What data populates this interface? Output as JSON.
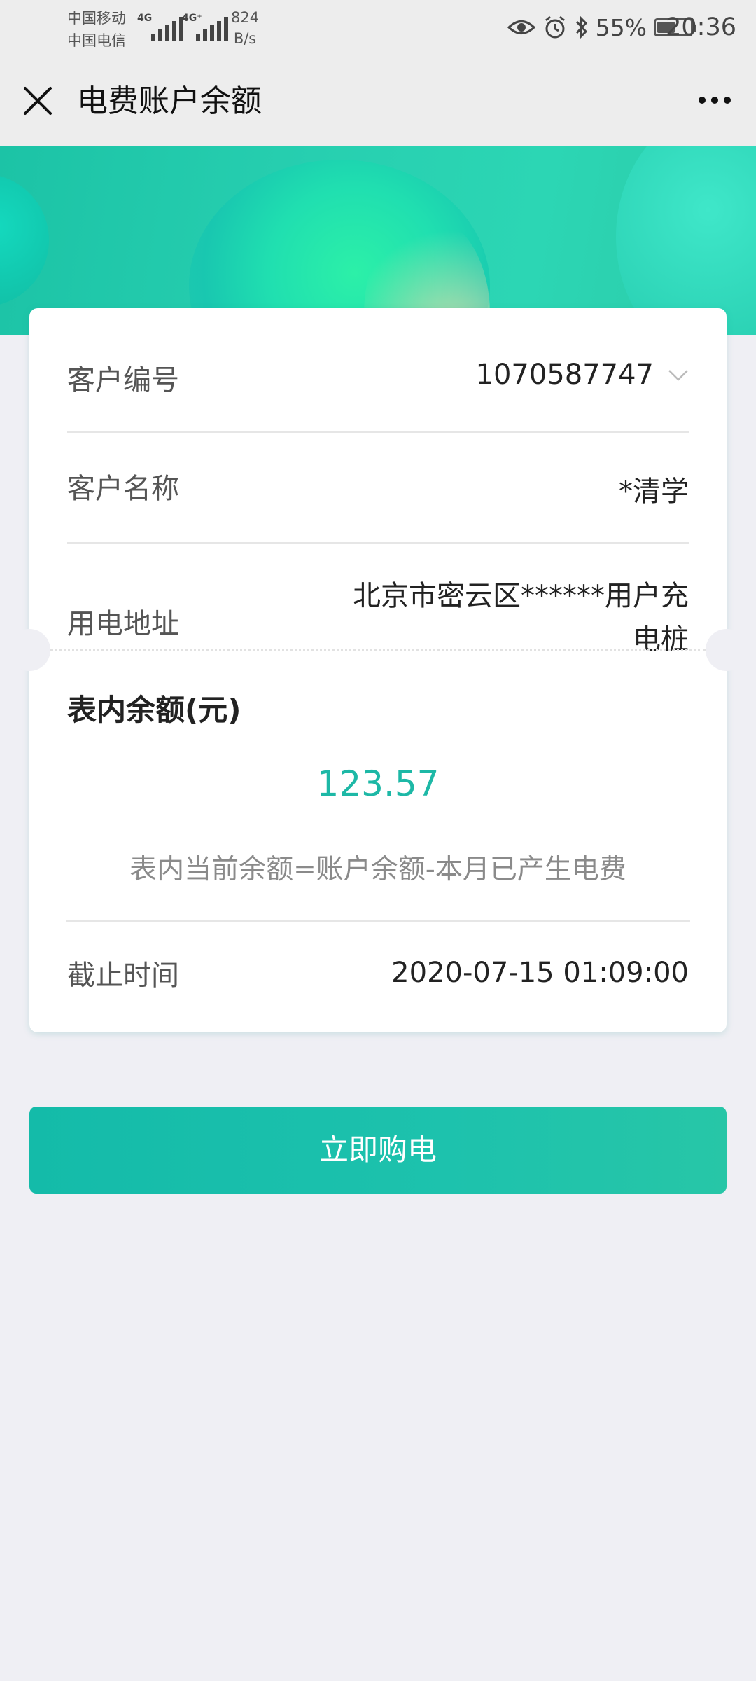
{
  "status_bar": {
    "carrier_1": "中国移动",
    "carrier_2": "中国电信",
    "net_1": "4G",
    "net_2": "4G⁺",
    "speed_value": "824",
    "speed_unit": "B/s",
    "battery_percent": "55%",
    "battery_level": 0.55,
    "time": "20:36"
  },
  "header": {
    "title": "电费账户余额"
  },
  "account": {
    "customer_no_label": "客户编号",
    "customer_no": "1070587747",
    "customer_name_label": "客户名称",
    "customer_name": "*清学",
    "address_label": "用电地址",
    "address_line1": "北京市密云区******用户充",
    "address_line2": "电桩"
  },
  "balance": {
    "title": "表内余额(元)",
    "value": "123.57",
    "note": "表内当前余额=账户余额-本月已产生电费",
    "deadline_label": "截止时间",
    "deadline_value": "2020-07-15 01:09:00"
  },
  "actions": {
    "buy_label": "立即购电"
  },
  "colors": {
    "accent": "#1db8a6",
    "banner": "#2ccfb0",
    "background": "#efeff4"
  }
}
